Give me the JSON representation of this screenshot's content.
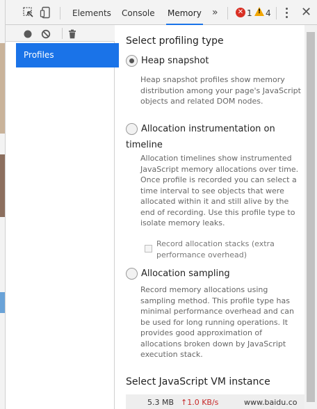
{
  "toolbar": {
    "tabs": [
      {
        "label": "Elements"
      },
      {
        "label": "Console"
      },
      {
        "label": "Memory"
      }
    ],
    "active_tab": "Memory",
    "more_label": "»",
    "error_count": "1",
    "warning_count": "4",
    "error_symbol": "✕",
    "warning_symbol": "!",
    "close_symbol": "✕"
  },
  "sidebar": {
    "items": [
      {
        "label": "Profiles"
      }
    ]
  },
  "main": {
    "section_title": "Select profiling type",
    "options": [
      {
        "label": "Heap snapshot",
        "checked": true,
        "description": "Heap snapshot profiles show memory distribution among your page's JavaScript objects and related DOM nodes."
      },
      {
        "label": "Allocation instrumentation on timeline",
        "label_line1": "Allocation instrumentation on",
        "label_line2": "timeline",
        "checked": false,
        "description": "Allocation timelines show instrumented JavaScript memory allocations over time. Once profile is recorded you can select a time interval to see objects that were allocated within it and still alive by the end of recording. Use this profile type to isolate memory leaks.",
        "sub_option": {
          "label": "Record allocation stacks (extra performance overhead)",
          "checked": false
        }
      },
      {
        "label": "Allocation sampling",
        "checked": false,
        "description": "Record memory allocations using sampling method. This profile type has minimal performance overhead and can be used for long running operations. It provides good approximation of allocations broken down by JavaScript execution stack."
      }
    ],
    "vm_title": "Select JavaScript VM instance",
    "vm_instance": {
      "heap_size": "5.3 MB",
      "rate": "↑1.0 KB/s",
      "url": "www.baidu.co"
    }
  },
  "colors": {
    "accent": "#1a73e8",
    "error": "#d93025",
    "warning": "#f2a600",
    "rate_up": "#c62828"
  },
  "icons": [
    "inspect-element-icon",
    "device-toolbar-icon",
    "record-icon",
    "clear-icon",
    "garbage-collect-icon",
    "more-tabs-icon",
    "kebab-menu-icon",
    "close-icon"
  ]
}
